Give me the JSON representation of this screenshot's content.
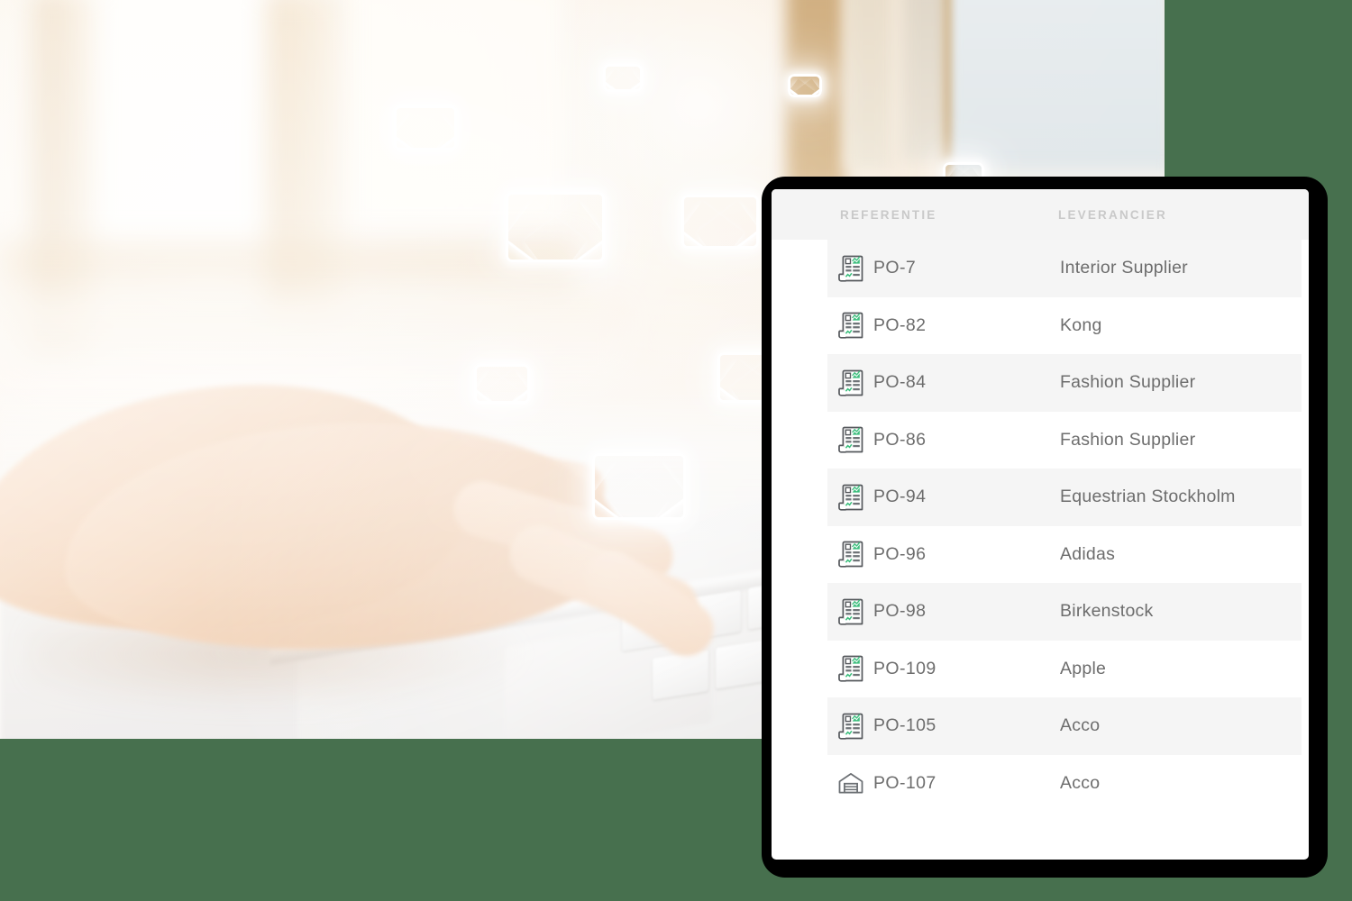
{
  "background": {
    "canvas_color": "#47704e",
    "photo": {
      "description": "hands typing on a laptop keyboard in bright warm light",
      "envelope_icon_name": "envelope-icon",
      "envelope_count": 8
    }
  },
  "panel": {
    "shadow_color": "#000000",
    "surface_color": "#ffffff",
    "header_background": "#f4f4f4",
    "stripe_color": "#f5f5f5",
    "text_color": "#6d6d6d",
    "header_text_color": "#c9c9c9",
    "accent_color": "#3fbf7f",
    "table": {
      "columns": [
        {
          "key": "reference",
          "label": "REFERENTIE"
        },
        {
          "key": "supplier",
          "label": "LEVERANCIER"
        }
      ],
      "rows": [
        {
          "icon": "purchase-order-document-icon",
          "reference": "PO-7",
          "supplier": "Interior Supplier"
        },
        {
          "icon": "purchase-order-document-icon",
          "reference": "PO-82",
          "supplier": "Kong"
        },
        {
          "icon": "purchase-order-document-icon",
          "reference": "PO-84",
          "supplier": "Fashion Supplier"
        },
        {
          "icon": "purchase-order-document-icon",
          "reference": "PO-86",
          "supplier": "Fashion Supplier"
        },
        {
          "icon": "purchase-order-document-icon",
          "reference": "PO-94",
          "supplier": "Equestrian Stockholm"
        },
        {
          "icon": "purchase-order-document-icon",
          "reference": "PO-96",
          "supplier": "Adidas"
        },
        {
          "icon": "purchase-order-document-icon",
          "reference": "PO-98",
          "supplier": "Birkenstock"
        },
        {
          "icon": "purchase-order-document-icon",
          "reference": "PO-109",
          "supplier": "Apple"
        },
        {
          "icon": "purchase-order-document-icon",
          "reference": "PO-105",
          "supplier": "Acco"
        },
        {
          "icon": "warehouse-icon",
          "reference": "PO-107",
          "supplier": "Acco"
        }
      ]
    }
  }
}
